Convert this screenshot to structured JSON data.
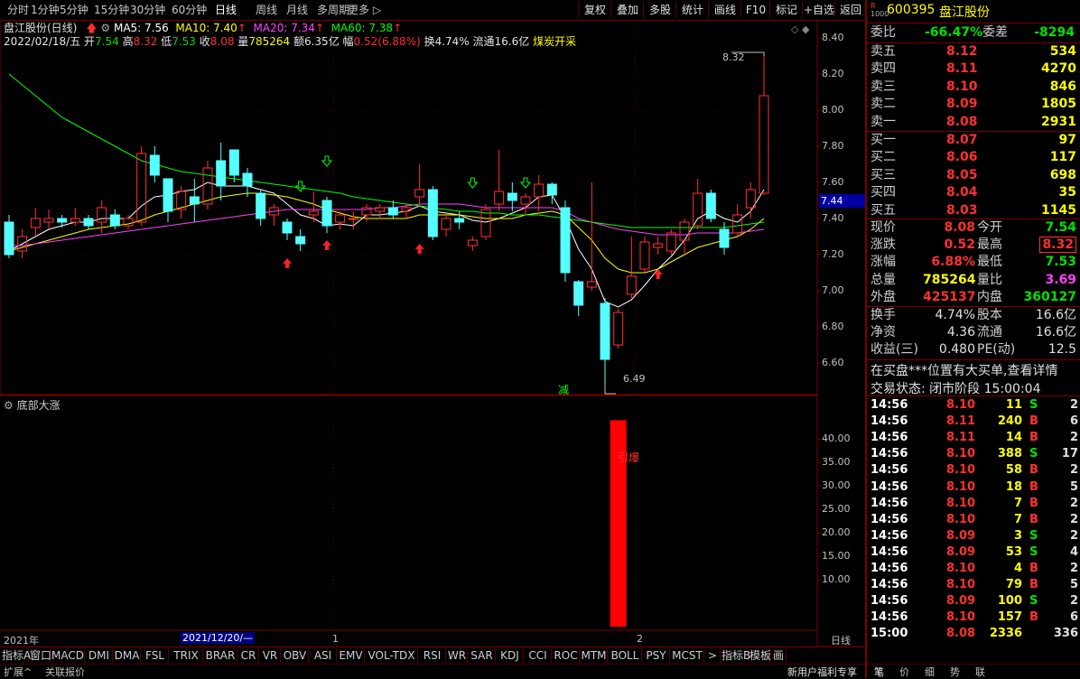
{
  "period_tabs": [
    "分时",
    "1分钟",
    "5分钟",
    "15分钟",
    "30分钟",
    "60分钟",
    "日线",
    "周线",
    "月线",
    "多周期",
    "更多"
  ],
  "active_period": "日线",
  "toolbar_buttons": [
    "复权",
    "叠加",
    "多股",
    "统计",
    "画线",
    "F10",
    "标记",
    "+自选",
    "返回"
  ],
  "info": {
    "title": "盘江股份(日线)",
    "ma5": "MA5: 7.56",
    "ma10": "MA10: 7.40",
    "ma20": "MA20: 7.34",
    "ma60": "MA60: 7.38",
    "date": "2022/02/18/五",
    "open_lbl": "开",
    "open": "7.54",
    "high_lbl": "高",
    "high": "8.32",
    "low_lbl": "低",
    "low": "7.53",
    "close_lbl": "收",
    "close": "8.08",
    "vol_lbl": "量",
    "vol": "785264",
    "amt_lbl": "额",
    "amt": "6.35亿",
    "chg_lbl": "幅",
    "chg": "0.52(6.88%)",
    "turn": "换4.74%",
    "float": "流通16.6亿",
    "concept": "煤炭开采"
  },
  "price_axis": [
    "8.40",
    "8.20",
    "8.00",
    "7.80",
    "7.60",
    "7.40",
    "7.20",
    "7.00",
    "6.80",
    "6.60"
  ],
  "current_price_tag": "7.44",
  "high_marker": "8.32",
  "low_marker": "6.49",
  "reduce_mark": "减",
  "indicator_title": "底部大涨",
  "indicator_axis": [
    "40.00",
    "35.00",
    "30.00",
    "25.00",
    "20.00",
    "15.00",
    "10.00"
  ],
  "indicator_label": "引爆",
  "indicator_bar_value": 44,
  "time_axis": {
    "year": "2021年",
    "cursor": "2021/12/20/—",
    "m1": "1",
    "m2": "2",
    "period": "日线"
  },
  "chart_data": {
    "type": "candlestick",
    "title": "盘江股份(日线)",
    "ylim": [
      6.45,
      8.45
    ],
    "candles": [
      [
        7.38,
        7.42,
        7.18,
        7.2
      ],
      [
        7.22,
        7.34,
        7.18,
        7.3
      ],
      [
        7.35,
        7.46,
        7.3,
        7.4
      ],
      [
        7.38,
        7.45,
        7.34,
        7.4
      ],
      [
        7.4,
        7.42,
        7.35,
        7.38
      ],
      [
        7.38,
        7.46,
        7.36,
        7.4
      ],
      [
        7.4,
        7.42,
        7.34,
        7.36
      ],
      [
        7.38,
        7.5,
        7.32,
        7.46
      ],
      [
        7.42,
        7.45,
        7.34,
        7.36
      ],
      [
        7.36,
        7.42,
        7.34,
        7.4
      ],
      [
        7.38,
        7.8,
        7.36,
        7.76
      ],
      [
        7.75,
        7.8,
        7.6,
        7.64
      ],
      [
        7.62,
        7.62,
        7.38,
        7.44
      ],
      [
        7.45,
        7.58,
        7.4,
        7.55
      ],
      [
        7.52,
        7.62,
        7.38,
        7.48
      ],
      [
        7.48,
        7.72,
        7.45,
        7.68
      ],
      [
        7.72,
        7.82,
        7.5,
        7.58
      ],
      [
        7.78,
        7.78,
        7.6,
        7.64
      ],
      [
        7.65,
        7.68,
        7.52,
        7.58
      ],
      [
        7.54,
        7.56,
        7.36,
        7.4
      ],
      [
        7.42,
        7.48,
        7.36,
        7.46
      ],
      [
        7.38,
        7.4,
        7.28,
        7.32
      ],
      [
        7.3,
        7.34,
        7.22,
        7.26
      ],
      [
        7.42,
        7.55,
        7.38,
        7.44
      ],
      [
        7.5,
        7.52,
        7.32,
        7.36
      ],
      [
        7.38,
        7.44,
        7.34,
        7.42
      ],
      [
        7.4,
        7.44,
        7.34,
        7.4
      ],
      [
        7.42,
        7.48,
        7.38,
        7.46
      ],
      [
        7.44,
        7.48,
        7.4,
        7.46
      ],
      [
        7.46,
        7.5,
        7.4,
        7.42
      ],
      [
        7.44,
        7.48,
        7.4,
        7.46
      ],
      [
        7.52,
        7.7,
        7.48,
        7.56
      ],
      [
        7.56,
        7.58,
        7.28,
        7.3
      ],
      [
        7.34,
        7.42,
        7.3,
        7.4
      ],
      [
        7.4,
        7.44,
        7.34,
        7.38
      ],
      [
        7.25,
        7.3,
        7.22,
        7.28
      ],
      [
        7.3,
        7.48,
        7.28,
        7.45
      ],
      [
        7.48,
        7.78,
        7.44,
        7.55
      ],
      [
        7.54,
        7.6,
        7.44,
        7.5
      ],
      [
        7.48,
        7.54,
        7.42,
        7.52
      ],
      [
        7.52,
        7.64,
        7.44,
        7.59
      ],
      [
        7.59,
        7.6,
        7.48,
        7.53
      ],
      [
        7.46,
        7.5,
        7.05,
        7.1
      ],
      [
        7.05,
        7.06,
        6.86,
        6.92
      ],
      [
        7.02,
        7.6,
        7.0,
        7.05
      ],
      [
        6.93,
        6.96,
        6.49,
        6.62
      ],
      [
        6.7,
        6.9,
        6.68,
        6.88
      ],
      [
        6.98,
        7.3,
        6.96,
        7.08
      ],
      [
        7.12,
        7.3,
        7.1,
        7.27
      ],
      [
        7.24,
        7.3,
        7.2,
        7.26
      ],
      [
        7.22,
        7.34,
        7.2,
        7.32
      ],
      [
        7.28,
        7.4,
        7.2,
        7.38
      ],
      [
        7.36,
        7.62,
        7.34,
        7.54
      ],
      [
        7.54,
        7.56,
        7.38,
        7.4
      ],
      [
        7.34,
        7.38,
        7.2,
        7.24
      ],
      [
        7.32,
        7.48,
        7.3,
        7.42
      ],
      [
        7.46,
        7.6,
        7.4,
        7.56
      ],
      [
        7.54,
        8.32,
        7.53,
        8.08
      ]
    ],
    "ma_series": [
      {
        "name": "MA5",
        "color": "#ffffff",
        "values": [
          7.22,
          7.26,
          7.3,
          7.34,
          7.36,
          7.38,
          7.38,
          7.4,
          7.4,
          7.4,
          7.47,
          7.52,
          7.53,
          7.55,
          7.56,
          7.6,
          7.58,
          7.58,
          7.58,
          7.56,
          7.54,
          7.48,
          7.42,
          7.4,
          7.36,
          7.37,
          7.36,
          7.42,
          7.42,
          7.43,
          7.44,
          7.47,
          7.44,
          7.43,
          7.42,
          7.39,
          7.38,
          7.4,
          7.43,
          7.46,
          7.52,
          7.53,
          7.4,
          7.23,
          7.12,
          6.94,
          6.91,
          6.95,
          7.03,
          7.12,
          7.19,
          7.28,
          7.4,
          7.44,
          7.4,
          7.38,
          7.44,
          7.56
        ]
      },
      {
        "name": "MA10",
        "color": "#ffff00",
        "values": [
          7.22,
          7.24,
          7.26,
          7.28,
          7.3,
          7.32,
          7.34,
          7.35,
          7.36,
          7.37,
          7.39,
          7.42,
          7.44,
          7.46,
          7.48,
          7.5,
          7.52,
          7.53,
          7.54,
          7.54,
          7.53,
          7.52,
          7.5,
          7.48,
          7.45,
          7.43,
          7.41,
          7.4,
          7.4,
          7.4,
          7.4,
          7.42,
          7.42,
          7.42,
          7.42,
          7.41,
          7.4,
          7.4,
          7.4,
          7.42,
          7.43,
          7.44,
          7.42,
          7.35,
          7.28,
          7.18,
          7.12,
          7.1,
          7.1,
          7.12,
          7.16,
          7.2,
          7.24,
          7.26,
          7.28,
          7.3,
          7.34,
          7.4
        ]
      },
      {
        "name": "MA20",
        "color": "#ff40ff",
        "values": [
          7.25,
          7.25,
          7.26,
          7.27,
          7.28,
          7.29,
          7.3,
          7.31,
          7.32,
          7.33,
          7.34,
          7.35,
          7.36,
          7.37,
          7.38,
          7.39,
          7.4,
          7.41,
          7.42,
          7.43,
          7.44,
          7.45,
          7.45,
          7.45,
          7.45,
          7.45,
          7.45,
          7.45,
          7.46,
          7.46,
          7.47,
          7.48,
          7.48,
          7.48,
          7.48,
          7.47,
          7.46,
          7.46,
          7.46,
          7.46,
          7.46,
          7.46,
          7.44,
          7.4,
          7.38,
          7.36,
          7.34,
          7.33,
          7.32,
          7.31,
          7.31,
          7.31,
          7.32,
          7.32,
          7.32,
          7.32,
          7.33,
          7.34
        ]
      },
      {
        "name": "MA60",
        "color": "#00ff00",
        "values": [
          8.2,
          8.14,
          8.08,
          8.02,
          7.96,
          7.92,
          7.88,
          7.84,
          7.8,
          7.76,
          7.72,
          7.7,
          7.68,
          7.66,
          7.65,
          7.64,
          7.63,
          7.62,
          7.61,
          7.6,
          7.59,
          7.58,
          7.57,
          7.56,
          7.55,
          7.54,
          7.52,
          7.51,
          7.5,
          7.49,
          7.48,
          7.47,
          7.46,
          7.45,
          7.44,
          7.44,
          7.43,
          7.43,
          7.42,
          7.42,
          7.42,
          7.41,
          7.4,
          7.39,
          7.38,
          7.37,
          7.36,
          7.35,
          7.35,
          7.35,
          7.35,
          7.35,
          7.35,
          7.35,
          7.35,
          7.36,
          7.37,
          7.38
        ]
      }
    ]
  },
  "quote": {
    "code": "600395",
    "name": "盘江股份",
    "weibi_lbl": "委比",
    "weibi": "-66.47%",
    "weicha_lbl": "委差",
    "weicha": "-8294",
    "asks": [
      {
        "label": "卖五",
        "price": "8.12",
        "vol": "534"
      },
      {
        "label": "卖四",
        "price": "8.11",
        "vol": "4270"
      },
      {
        "label": "卖三",
        "price": "8.10",
        "vol": "846"
      },
      {
        "label": "卖二",
        "price": "8.09",
        "vol": "1805"
      },
      {
        "label": "卖一",
        "price": "8.08",
        "vol": "2931"
      }
    ],
    "bids": [
      {
        "label": "买一",
        "price": "8.07",
        "vol": "97"
      },
      {
        "label": "买二",
        "price": "8.06",
        "vol": "117"
      },
      {
        "label": "买三",
        "price": "8.05",
        "vol": "698"
      },
      {
        "label": "买四",
        "price": "8.04",
        "vol": "35"
      },
      {
        "label": "买五",
        "price": "8.03",
        "vol": "1145"
      }
    ],
    "stats": [
      {
        "l1": "现价",
        "v1": "8.08",
        "l2": "今开",
        "v2": "7.54"
      },
      {
        "l1": "涨跌",
        "v1": "0.52",
        "l2": "最高",
        "v2": "8.32"
      },
      {
        "l1": "涨幅",
        "v1": "6.88%",
        "l2": "最低",
        "v2": "7.53"
      },
      {
        "l1": "总量",
        "v1": "785264",
        "l2": "量比",
        "v2": "3.69"
      },
      {
        "l1": "外盘",
        "v1": "425137",
        "l2": "内盘",
        "v2": "360127"
      }
    ],
    "fund": [
      {
        "l1": "换手",
        "v1": "4.74%",
        "l2": "股本",
        "v2": "16.6亿"
      },
      {
        "l1": "净资",
        "v1": "4.36",
        "l2": "流通",
        "v2": "16.6亿"
      },
      {
        "l1": "收益(三)",
        "v1": "0.480",
        "l2": "PE(动)",
        "v2": "12.5"
      }
    ],
    "notice": "在买盘***位置有大买单,查看详情",
    "trade_status": "交易状态: 闭市阶段 15:00:04",
    "ticks": [
      {
        "t": "14:56",
        "p": "8.10",
        "v": "11",
        "s": "S",
        "n": "2"
      },
      {
        "t": "14:56",
        "p": "8.11",
        "v": "240",
        "s": "B",
        "n": "6"
      },
      {
        "t": "14:56",
        "p": "8.11",
        "v": "14",
        "s": "B",
        "n": "2"
      },
      {
        "t": "14:56",
        "p": "8.10",
        "v": "388",
        "s": "S",
        "n": "17"
      },
      {
        "t": "14:56",
        "p": "8.10",
        "v": "58",
        "s": "B",
        "n": "2"
      },
      {
        "t": "14:56",
        "p": "8.10",
        "v": "18",
        "s": "B",
        "n": "5"
      },
      {
        "t": "14:56",
        "p": "8.10",
        "v": "7",
        "s": "B",
        "n": "2"
      },
      {
        "t": "14:56",
        "p": "8.10",
        "v": "7",
        "s": "B",
        "n": "2"
      },
      {
        "t": "14:56",
        "p": "8.09",
        "v": "3",
        "s": "S",
        "n": "2"
      },
      {
        "t": "14:56",
        "p": "8.09",
        "v": "53",
        "s": "S",
        "n": "4"
      },
      {
        "t": "14:56",
        "p": "8.10",
        "v": "4",
        "s": "B",
        "n": "2"
      },
      {
        "t": "14:56",
        "p": "8.10",
        "v": "79",
        "s": "B",
        "n": "5"
      },
      {
        "t": "14:56",
        "p": "8.09",
        "v": "100",
        "s": "S",
        "n": "2"
      },
      {
        "t": "14:56",
        "p": "8.10",
        "v": "157",
        "s": "B",
        "n": "6"
      },
      {
        "t": "15:00",
        "p": "8.08",
        "v": "2336",
        "s": "",
        "n": "336"
      }
    ]
  },
  "indicator_tabs": [
    "指标A",
    "窗口",
    "MACD",
    "DMI",
    "DMA",
    "FSL",
    "TRIX",
    "BRAR",
    "CR",
    "VR",
    "OBV",
    "ASI",
    "EMV",
    "VOL-TDX",
    "RSI",
    "WR",
    "SAR",
    "KDJ",
    "CCI",
    "ROC",
    "MTM",
    "BOLL",
    "PSY",
    "MCST",
    ">",
    "指标B",
    "模板",
    "画"
  ],
  "status_bar": {
    "left1": "扩展^",
    "left2": "关联报价",
    "right": "新用户福利专享",
    "tab1": "笔",
    "tab2": "价",
    "tab3": "细",
    "tab4": "势",
    "tab5": "联"
  }
}
